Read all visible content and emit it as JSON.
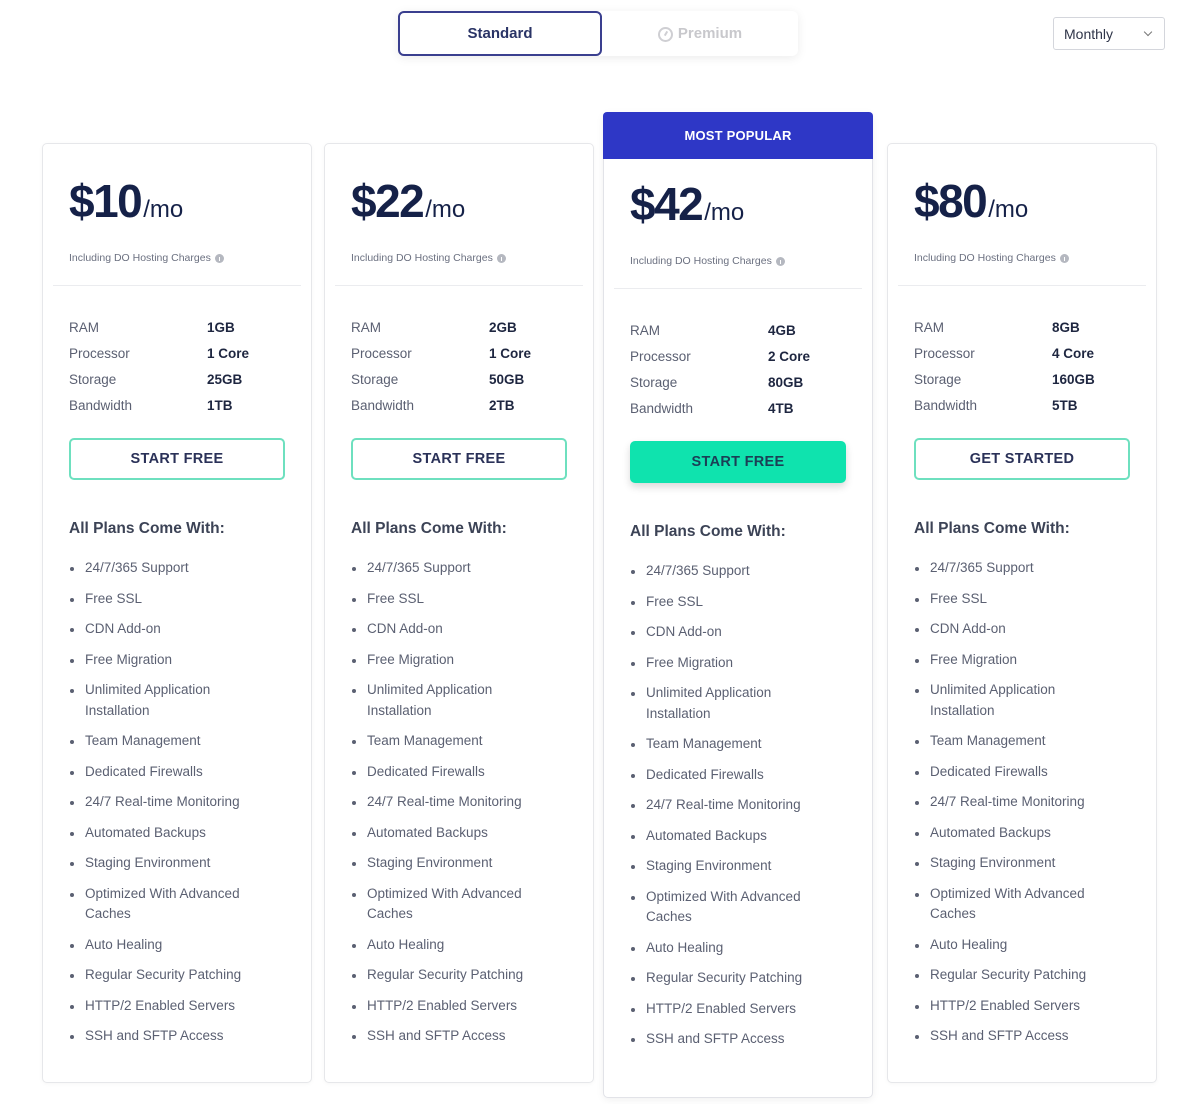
{
  "plan_type_toggle": {
    "options": [
      "Standard",
      "Premium"
    ],
    "selected": "Standard"
  },
  "billing": {
    "selected": "Monthly"
  },
  "labels": {
    "charges_note": "Including DO Hosting Charges",
    "features_title": "All Plans Come With:",
    "popular_badge": "MOST POPULAR",
    "spec_labels": [
      "RAM",
      "Processor",
      "Storage",
      "Bandwidth"
    ]
  },
  "plans": [
    {
      "price": "$10",
      "period": "/mo",
      "specs": [
        "1GB",
        "1 Core",
        "25GB",
        "1TB"
      ],
      "cta": "START FREE",
      "popular": false
    },
    {
      "price": "$22",
      "period": "/mo",
      "specs": [
        "2GB",
        "1 Core",
        "50GB",
        "2TB"
      ],
      "cta": "START FREE",
      "popular": false
    },
    {
      "price": "$42",
      "period": "/mo",
      "specs": [
        "4GB",
        "2 Core",
        "80GB",
        "4TB"
      ],
      "cta": "START FREE",
      "popular": true
    },
    {
      "price": "$80",
      "period": "/mo",
      "specs": [
        "8GB",
        "4 Core",
        "160GB",
        "5TB"
      ],
      "cta": "GET STARTED",
      "popular": false
    }
  ],
  "features": [
    "24/7/365 Support",
    "Free SSL",
    "CDN Add-on",
    "Free Migration",
    "Unlimited Application Installation",
    "Team Management",
    "Dedicated Firewalls",
    "24/7 Real-time Monitoring",
    "Automated Backups",
    "Staging Environment",
    "Optimized With Advanced Caches",
    "Auto Healing",
    "Regular Security Patching",
    "HTTP/2 Enabled Servers",
    "SSH and SFTP Access"
  ],
  "colors": {
    "accent_blue": "#2e37c6",
    "cta_green": "#0fe3ae",
    "cta_outline": "#6ee0bf",
    "text_dark": "#152148"
  }
}
